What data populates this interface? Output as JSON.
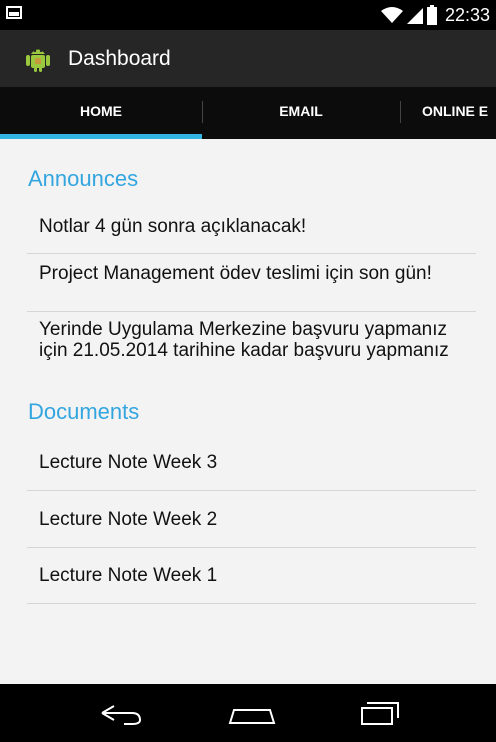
{
  "status_bar": {
    "time": "22:33",
    "icons": [
      "notification-image-icon",
      "wifi-icon",
      "signal-icon",
      "battery-icon"
    ]
  },
  "action_bar": {
    "title": "Dashboard",
    "icon": "android-app-icon"
  },
  "tabs": [
    {
      "label": "HOME",
      "selected": true
    },
    {
      "label": "EMAIL",
      "selected": false
    },
    {
      "label": "ONLINE E",
      "selected": false
    }
  ],
  "announces": {
    "title": "Announces",
    "items": [
      "Notlar 4 gün sonra açıklanacak!",
      "Project Management ödev teslimi için son gün!",
      "Yerinde Uygulama Merkezine başvuru yapmanız için 21.05.2014 tarihine kadar başvuru yapmanız"
    ]
  },
  "documents": {
    "title": "Documents",
    "items": [
      "Lecture Note Week 3",
      "Lecture Note Week 2",
      "Lecture Note Week 1"
    ]
  },
  "nav_bar": {
    "buttons": [
      "back-icon",
      "home-icon",
      "recent-apps-icon"
    ]
  },
  "colors": {
    "accent": "#33b5e5",
    "section_title": "#33a6e0",
    "action_bar": "#262626",
    "tabs_bg": "#0c0c0c"
  }
}
